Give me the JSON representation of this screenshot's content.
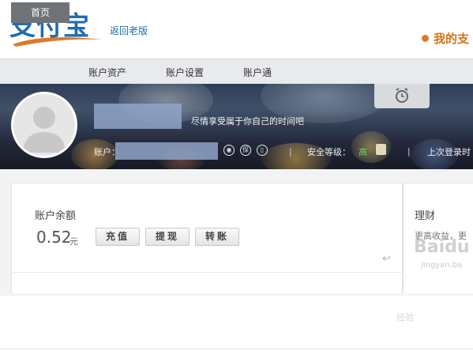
{
  "header": {
    "logo_text": "支付宝",
    "back_link": "返回老版",
    "my_alipay": "我的支"
  },
  "nav": {
    "items": [
      {
        "label": "首页",
        "active": true
      },
      {
        "label": "账户资产",
        "active": false
      },
      {
        "label": "账户设置",
        "active": false
      },
      {
        "label": "账户通",
        "active": false
      }
    ]
  },
  "profile": {
    "slogan": "尽情享受属于你自己的时间吧",
    "account_label": "账户：",
    "security_label": "安全等级：",
    "security_level": "高",
    "last_login": "上次登录时"
  },
  "balance": {
    "title": "账户余额",
    "amount": "0.52",
    "unit": "元",
    "buttons": [
      "充值",
      "提现",
      "转账"
    ]
  },
  "licai": {
    "title": "理财",
    "subtitle": "更高收益，更"
  },
  "watermark": {
    "main": "Baidu",
    "sub": "jingyan.ba",
    "bottom": "经验"
  },
  "colors": {
    "brand_blue": "#1f6db0",
    "orange": "#d4731b",
    "nav_active": "#6f7378",
    "security_green": "#5fd35f"
  }
}
